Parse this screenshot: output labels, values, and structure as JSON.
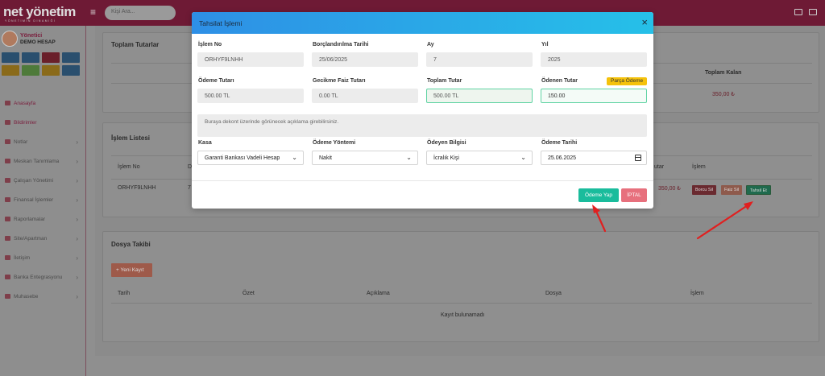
{
  "app": {
    "logo": "net yönetim",
    "logo_sub": "YÖNETİMİN DİNAMİĞİ",
    "search_placeholder": "Kişi Ara..."
  },
  "user": {
    "role": "Yönetici",
    "name": "DEMO HESAP"
  },
  "sidebar": {
    "items": [
      {
        "label": "Anasayfa",
        "active": true
      },
      {
        "label": "Bildirimler",
        "active": true
      },
      {
        "label": "Notlar",
        "chevron": true
      },
      {
        "label": "Meskan Tanımlama",
        "chevron": true
      },
      {
        "label": "Çalışan Yönetimi",
        "chevron": true
      },
      {
        "label": "Finansal İşlemler",
        "chevron": true
      },
      {
        "label": "Raporlamalar",
        "chevron": true
      },
      {
        "label": "Site/Apartman",
        "chevron": true
      },
      {
        "label": "İletişim",
        "chevron": true
      },
      {
        "label": "Banka Entegrasyonu",
        "chevron": true
      },
      {
        "label": "Muhasebe",
        "chevron": true
      }
    ]
  },
  "background": {
    "totals_title": "Toplam Tutarlar",
    "totals_col_remaining": "Toplam Kalan",
    "totals_value_remaining": "350,00 ₺",
    "list_title": "İşlem Listesi",
    "list_col_id": "İşlem No",
    "list_col_d": "D",
    "list_col_tutar": "utar",
    "list_col_islem": "İşlem",
    "list_row_id": "ORHYF9LNHH",
    "list_row_seven": "7",
    "list_row_amount": "350,00 ₺",
    "row_btn_delete": "Borcu Sil",
    "row_btn_edit": "Faiz Sil",
    "row_btn_collect": "Tahsil Et",
    "files_title": "Dosya Takibi",
    "new_record_btn": "+ Yeni Kayıt",
    "files_cols": [
      "Tarih",
      "Özet",
      "Açıklama",
      "Dosya",
      "İşlem"
    ],
    "files_empty": "Kayıt bulunamadı"
  },
  "modal": {
    "title": "Tahsilat İşlemi",
    "close": "×",
    "fields": {
      "islem_no_label": "İşlem No",
      "islem_no_value": "ORHYF9LNHH",
      "borc_tarihi_label": "Borçlandırılma Tarihi",
      "borc_tarihi_value": "25/06/2025",
      "ay_label": "Ay",
      "ay_value": "7",
      "yil_label": "Yıl",
      "yil_value": "2025",
      "odeme_tutari_label": "Ödeme Tutarı",
      "odeme_tutari_value": "500.00 TL",
      "gecikme_label": "Gecikme Faiz Tutarı",
      "gecikme_value": "0.00 TL",
      "toplam_label": "Toplam Tutar",
      "toplam_value": "500.00 TL",
      "odenen_label": "Ödenen Tutar",
      "odenen_value": "150.00",
      "parca_badge": "Parça Ödeme",
      "aciklama_placeholder": "Buraya dekont üzerinde görünecek açıklama girebilirsiniz.",
      "kasa_label": "Kasa",
      "kasa_value": "Garanti Bankası Vadeli Hesap",
      "yontem_label": "Ödeme Yöntemi",
      "yontem_value": "Nakit",
      "odeyen_label": "Ödeyen Bilgisi",
      "odeyen_value": "İcralık Kişi",
      "tarih_label": "Ödeme Tarihi",
      "tarih_value": "25.06.2025"
    },
    "buttons": {
      "pay": "Ödeme Yap",
      "cancel": "İPTAL"
    }
  },
  "colors": {
    "brand": "#7a1d3c",
    "modal_header_start": "#2e8fe6",
    "modal_header_end": "#26c0e8",
    "pay_button": "#1abc9c",
    "cancel_button": "#e7707d",
    "badge": "#f5c20b",
    "annotation_arrow": "#e02020"
  }
}
